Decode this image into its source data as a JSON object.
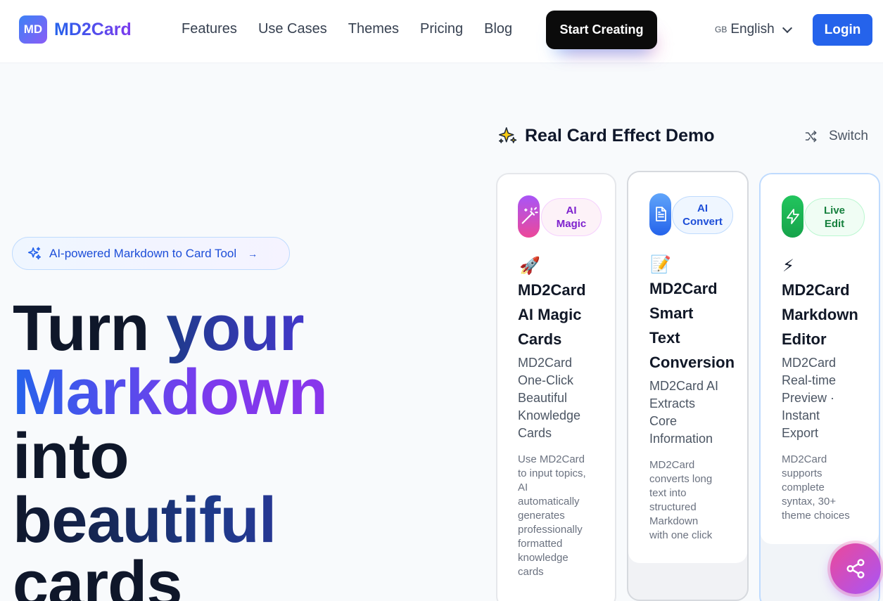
{
  "brand": {
    "logo_badge": "MD",
    "name": "MD2Card"
  },
  "nav": [
    "Features",
    "Use Cases",
    "Themes",
    "Pricing",
    "Blog"
  ],
  "cta_label": "Start Creating",
  "language": {
    "flag": "GB",
    "label": "English"
  },
  "login_label": "Login",
  "hero": {
    "pill_text": "AI-powered Markdown to Card Tool",
    "pill_arrow": "→",
    "headline": {
      "part1": "Turn ",
      "part2": "your",
      "part3": "Markdown",
      "part4": "into",
      "part5": "beautiful",
      "part6": "cards"
    }
  },
  "demo": {
    "title": "Real Card Effect Demo",
    "title_icon": "sparkles-icon",
    "switch_label": "Switch",
    "cards": [
      {
        "badge": [
          "AI",
          "Magic"
        ],
        "emoji": "🚀",
        "title": [
          "MD2Card",
          "AI Magic",
          "Cards"
        ],
        "subtitle": [
          "MD2Card",
          "One-Click",
          "Beautiful",
          "Knowledge",
          "Cards"
        ],
        "desc": [
          "Use MD2Card",
          "to input topics,",
          "AI",
          "automatically",
          "generates",
          "professionally",
          "formatted",
          "knowledge",
          "cards"
        ],
        "icon": "wand-icon",
        "accent": "#ec4899"
      },
      {
        "badge": [
          "AI",
          "Convert"
        ],
        "emoji": "📝",
        "title": [
          "MD2Card",
          "Smart",
          "Text",
          "Conversion"
        ],
        "subtitle": [
          "MD2Card AI",
          "Extracts",
          "Core",
          "Information"
        ],
        "desc": [
          "MD2Card",
          "converts long",
          "text into",
          "structured",
          "Markdown",
          "with one click"
        ],
        "icon": "document-icon",
        "accent": "#3b82f6"
      },
      {
        "badge": [
          "Live",
          "Edit"
        ],
        "emoji": "⚡",
        "title": [
          "MD2Card",
          "Markdown",
          "Editor"
        ],
        "subtitle": [
          "MD2Card",
          "Real-time",
          "Preview ·",
          "Instant",
          "Export"
        ],
        "desc": [
          "MD2Card",
          "supports",
          "complete",
          "syntax, 30+",
          "theme choices"
        ],
        "icon": "lightning-icon",
        "accent": "#22c55e"
      }
    ]
  }
}
